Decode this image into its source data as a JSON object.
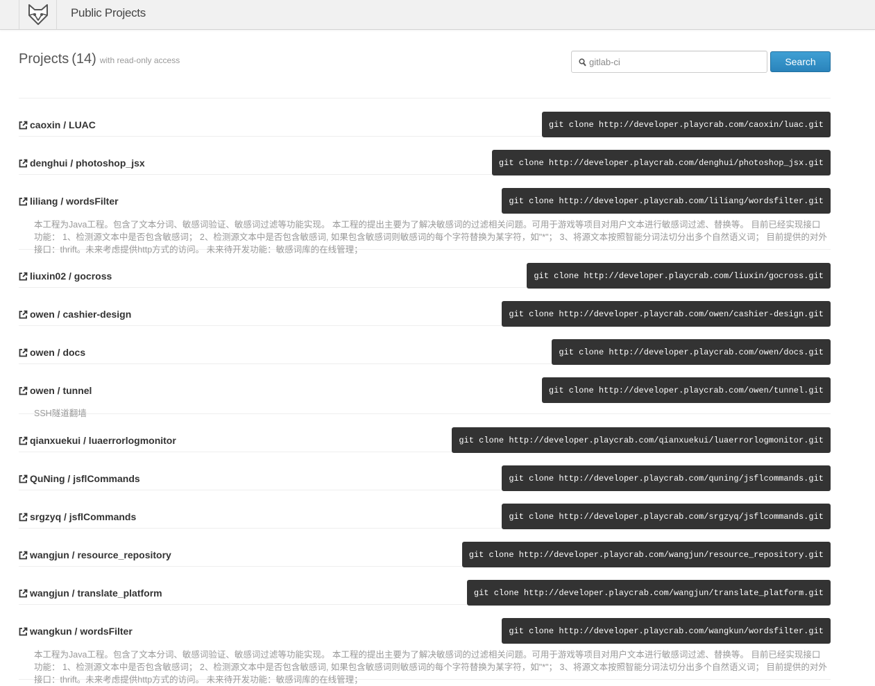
{
  "header": {
    "title": "Public Projects"
  },
  "heading": {
    "title": "Projects",
    "count": "(14)",
    "subtitle": "with read-only access"
  },
  "search": {
    "value": "gitlab-ci",
    "button_label": "Search"
  },
  "projects": [
    {
      "name": "caoxin / LUAC",
      "clone": "git clone http://developer.playcrab.com/caoxin/luac.git",
      "description": ""
    },
    {
      "name": "denghui / photoshop_jsx",
      "clone": "git clone http://developer.playcrab.com/denghui/photoshop_jsx.git",
      "description": ""
    },
    {
      "name": "liliang / wordsFilter",
      "clone": "git clone http://developer.playcrab.com/liliang/wordsfilter.git",
      "description": "本工程为Java工程。包含了文本分词、敏感词验证、敏感词过滤等功能实现。 本工程的提出主要为了解决敏感词的过滤相关问题。可用于游戏等项目对用户文本进行敏感词过滤、替换等。 目前已经实现接口功能： 1、检测源文本中是否包含敏感词； 2、检测源文本中是否包含敏感词, 如果包含敏感词则敏感词的每个字符替换为某字符，如\"*\"； 3、将源文本按照智能分词法切分出多个自然语义词； 目前提供的对外接口：thrift。未来考虑提供http方式的访问。 未来待开发功能：敏感词库的在线管理；"
    },
    {
      "name": "liuxin02 / gocross",
      "clone": "git clone http://developer.playcrab.com/liuxin/gocross.git",
      "description": ""
    },
    {
      "name": "owen / cashier-design",
      "clone": "git clone http://developer.playcrab.com/owen/cashier-design.git",
      "description": ""
    },
    {
      "name": "owen / docs",
      "clone": "git clone http://developer.playcrab.com/owen/docs.git",
      "description": ""
    },
    {
      "name": "owen / tunnel",
      "clone": "git clone http://developer.playcrab.com/owen/tunnel.git",
      "description": "SSH隧道翻墙"
    },
    {
      "name": "qianxuekui / luaerrorlogmonitor",
      "clone": "git clone http://developer.playcrab.com/qianxuekui/luaerrorlogmonitor.git",
      "description": ""
    },
    {
      "name": "QuNing / jsflCommands",
      "clone": "git clone http://developer.playcrab.com/quning/jsflcommands.git",
      "description": ""
    },
    {
      "name": "srgzyq / jsflCommands",
      "clone": "git clone http://developer.playcrab.com/srgzyq/jsflcommands.git",
      "description": ""
    },
    {
      "name": "wangjun / resource_repository",
      "clone": "git clone http://developer.playcrab.com/wangjun/resource_repository.git",
      "description": ""
    },
    {
      "name": "wangjun / translate_platform",
      "clone": "git clone http://developer.playcrab.com/wangjun/translate_platform.git",
      "description": ""
    },
    {
      "name": "wangkun / wordsFilter",
      "clone": "git clone http://developer.playcrab.com/wangkun/wordsfilter.git",
      "description": "本工程为Java工程。包含了文本分词、敏感词验证、敏感词过滤等功能实现。 本工程的提出主要为了解决敏感词的过滤相关问题。可用于游戏等项目对用户文本进行敏感词过滤、替换等。 目前已经实现接口功能： 1、检测源文本中是否包含敏感词； 2、检测源文本中是否包含敏感词, 如果包含敏感词则敏感词的每个字符替换为某字符，如\"*\"； 3、将源文本按照智能分词法切分出多个自然语义词； 目前提供的对外接口：thrift。未来考虑提供http方式的访问。 未来待开发功能：敏感词库的在线管理；"
    }
  ],
  "icons": {
    "logo": "fox-logo-icon",
    "search": "search-icon",
    "project": "external-link-icon"
  }
}
